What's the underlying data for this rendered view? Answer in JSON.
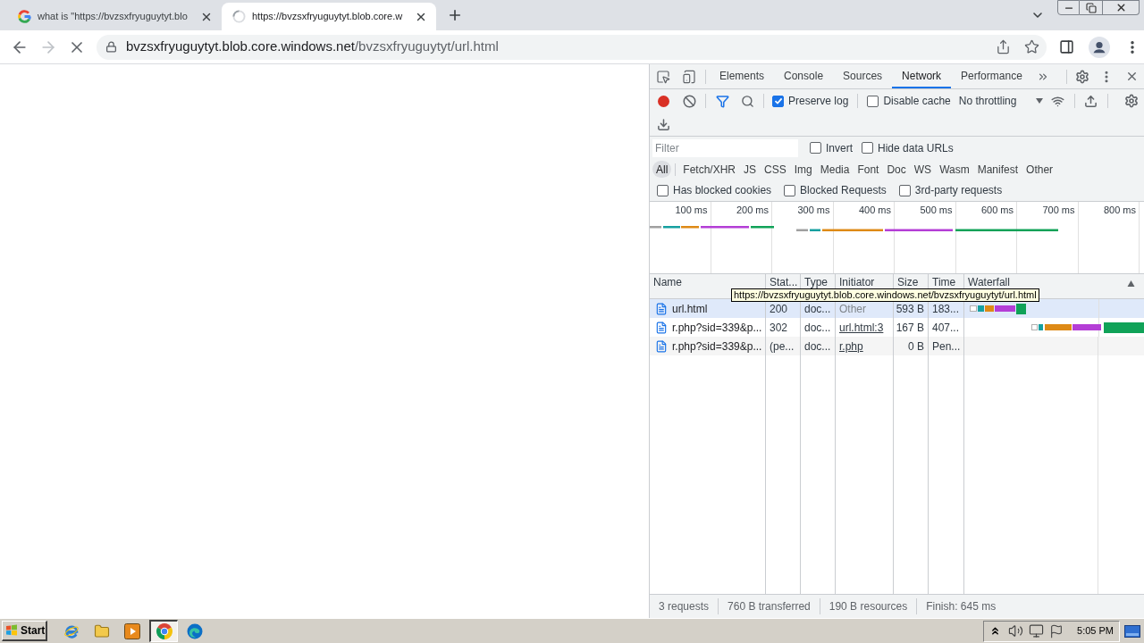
{
  "tabs": [
    {
      "title": "what is \"https://bvzsxfryuguytyt.blo",
      "selected": false,
      "loading": false
    },
    {
      "title": "https://bvzsxfryuguytyt.blob.core.w",
      "selected": true,
      "loading": true
    }
  ],
  "nav_buttons": [
    {
      "kind": "back",
      "disabled": false
    },
    {
      "kind": "forward",
      "disabled": true
    },
    {
      "kind": "stop",
      "disabled": false
    }
  ],
  "address": {
    "host": "bvzsxfryuguytyt.blob.core.windows.net",
    "path": "/bvzsxfryuguytyt/url.html"
  },
  "devtools": {
    "tabs": [
      {
        "label": "Elements",
        "selected": false
      },
      {
        "label": "Console",
        "selected": false
      },
      {
        "label": "Sources",
        "selected": false
      },
      {
        "label": "Network",
        "selected": true
      },
      {
        "label": "Performance",
        "selected": false
      }
    ],
    "toolbar": {
      "recording": true,
      "filter_shown": true,
      "options": [
        {
          "label": "Preserve log",
          "checked": true
        },
        {
          "label": "Disable cache",
          "checked": false
        }
      ],
      "throttling": "No throttling"
    },
    "filter": {
      "placeholder": "Filter",
      "options": [
        {
          "label": "Invert",
          "checked": false
        },
        {
          "label": "Hide data URLs",
          "checked": false
        }
      ]
    },
    "types": [
      {
        "label": "All",
        "selected": true
      },
      {
        "label": "Fetch/XHR",
        "selected": false
      },
      {
        "label": "JS",
        "selected": false
      },
      {
        "label": "CSS",
        "selected": false
      },
      {
        "label": "Img",
        "selected": false
      },
      {
        "label": "Media",
        "selected": false
      },
      {
        "label": "Font",
        "selected": false
      },
      {
        "label": "Doc",
        "selected": false
      },
      {
        "label": "WS",
        "selected": false
      },
      {
        "label": "Wasm",
        "selected": false
      },
      {
        "label": "Manifest",
        "selected": false
      },
      {
        "label": "Other",
        "selected": false
      }
    ],
    "request_options": [
      {
        "label": "Has blocked cookies",
        "checked": false
      },
      {
        "label": "Blocked Requests",
        "checked": false
      },
      {
        "label": "3rd-party requests",
        "checked": false
      }
    ],
    "overview": {
      "ticks": [
        "100 ms",
        "200 ms",
        "300 ms",
        "400 ms",
        "500 ms",
        "600 ms",
        "700 ms",
        "800 ms"
      ]
    },
    "table": {
      "columns": [
        "Name",
        "Stat...",
        "Type",
        "Initiator",
        "Size",
        "Time",
        "Waterfall"
      ],
      "tooltip": "https://bvzsxfryuguytyt.blob.core.windows.net/bvzsxfryuguytyt/url.html",
      "rows": [
        {
          "name": "url.html",
          "status": "200",
          "type": "doc...",
          "initiator": "Other",
          "initiator_link": false,
          "size": "593 B",
          "time": "183...",
          "hovered": true
        },
        {
          "name": "r.php?sid=339&p...",
          "status": "302",
          "type": "doc...",
          "initiator": "url.html:3",
          "initiator_link": true,
          "size": "167 B",
          "time": "407...",
          "hovered": false
        },
        {
          "name": "r.php?sid=339&p...",
          "status": "(pe...",
          "type": "doc...",
          "initiator": "r.php",
          "initiator_link": true,
          "size": "0 B",
          "time": "Pen...",
          "hovered": false
        }
      ]
    },
    "summary": [
      "3 requests",
      "760 B transferred",
      "190 B resources",
      "Finish: 645 ms"
    ]
  },
  "taskbar": {
    "start": "Start",
    "apps": [
      {
        "kind": "e-logo",
        "active": false
      },
      {
        "kind": "folder",
        "active": false
      },
      {
        "kind": "media",
        "active": false
      },
      {
        "kind": "ring-logo",
        "active": true
      },
      {
        "kind": "wave-logo",
        "active": false
      }
    ],
    "clock": "5:05 PM"
  }
}
